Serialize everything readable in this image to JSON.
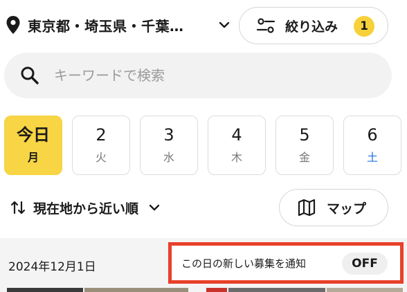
{
  "header": {
    "location_label": "東京都・埼玉県・千葉…",
    "filter": {
      "label": "絞り込み",
      "badge": "1"
    }
  },
  "search": {
    "placeholder": "キーワードで検索",
    "value": ""
  },
  "dates": [
    {
      "day": "今日",
      "weekday": "月",
      "selected": true
    },
    {
      "day": "2",
      "weekday": "火",
      "selected": false
    },
    {
      "day": "3",
      "weekday": "水",
      "selected": false
    },
    {
      "day": "4",
      "weekday": "木",
      "selected": false
    },
    {
      "day": "5",
      "weekday": "金",
      "selected": false
    },
    {
      "day": "6",
      "weekday": "土",
      "selected": false
    }
  ],
  "sort": {
    "label": "現在地から近い順"
  },
  "map_button": {
    "label": "マップ"
  },
  "section": {
    "date": "2024年12月1日",
    "notify_label": "この日の新しい募集を通知",
    "notify_state": "OFF"
  },
  "colors": {
    "accent_yellow": "#f7d544",
    "saturday_blue": "#1e6fd9",
    "highlight_red": "#e8402a"
  },
  "icons": {
    "location": "map-pin-icon",
    "dropdown": "chevron-down-icon",
    "filter": "sliders-icon",
    "search": "search-icon",
    "sort": "sort-arrows-icon",
    "map": "map-icon"
  }
}
